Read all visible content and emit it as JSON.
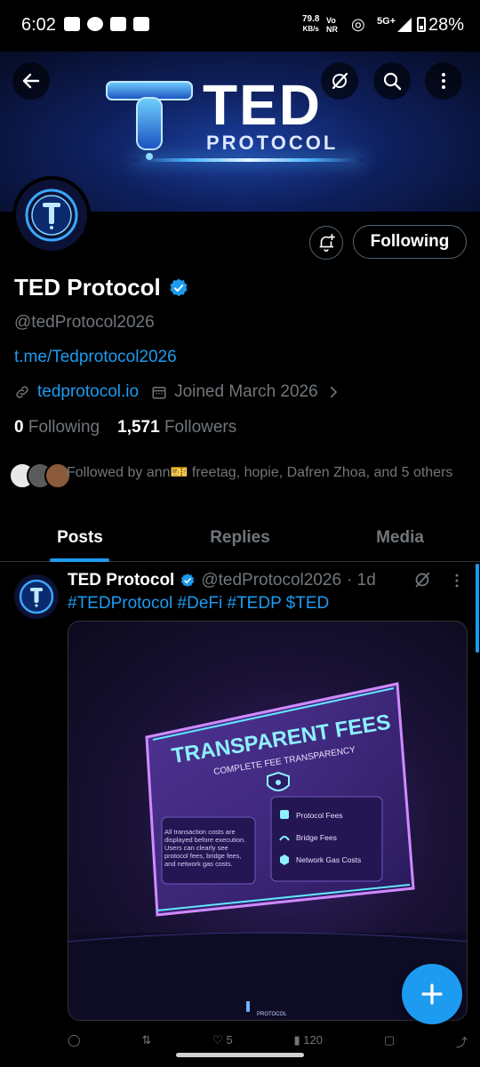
{
  "status_bar": {
    "time": "6:02",
    "net_speed": "79.8",
    "net_unit": "KB/s",
    "volte": "Vo",
    "volte_sub": "NR",
    "network": "5G+",
    "battery": "28%"
  },
  "banner": {
    "brand": "TED",
    "brand_sub": "PROTOCOL"
  },
  "profile": {
    "following_button": "Following",
    "name": "TED Protocol",
    "handle": "@tedProtocol2026",
    "bio_link": "t.me/Tedprotocol2026",
    "website": "tedprotocol.io",
    "joined": "Joined March 2026",
    "following_count": "0",
    "following_label": "Following",
    "followers_count": "1,571",
    "followers_label": "Followers",
    "followed_by": "Followed by ann🎫 freetag, hopie, Dafren Zhoa, and 5 others"
  },
  "tabs": [
    {
      "label": "Posts"
    },
    {
      "label": "Replies"
    },
    {
      "label": "Media"
    }
  ],
  "post": {
    "name": "TED Protocol",
    "handle": "@tedProtocol2026",
    "time": "· 1d",
    "text": "#TEDProtocol #DeFi #TEDP $TED",
    "media": {
      "title": "TRANSPARENT FEES",
      "subtitle": "COMPLETE FEE TRANSPARENCY",
      "body": "All transaction costs are displayed before execution. Users can clearly see protocol fees, bridge fees, and network gas costs.",
      "items": [
        "Protocol Fees",
        "Bridge Fees",
        "Network Gas Costs"
      ],
      "footer": "PROTOCOL"
    },
    "actions": {
      "likes": "5",
      "views": "120"
    }
  },
  "colors": {
    "accent": "#1d9bf0",
    "background": "#000000",
    "secondary_text": "#71767b"
  }
}
